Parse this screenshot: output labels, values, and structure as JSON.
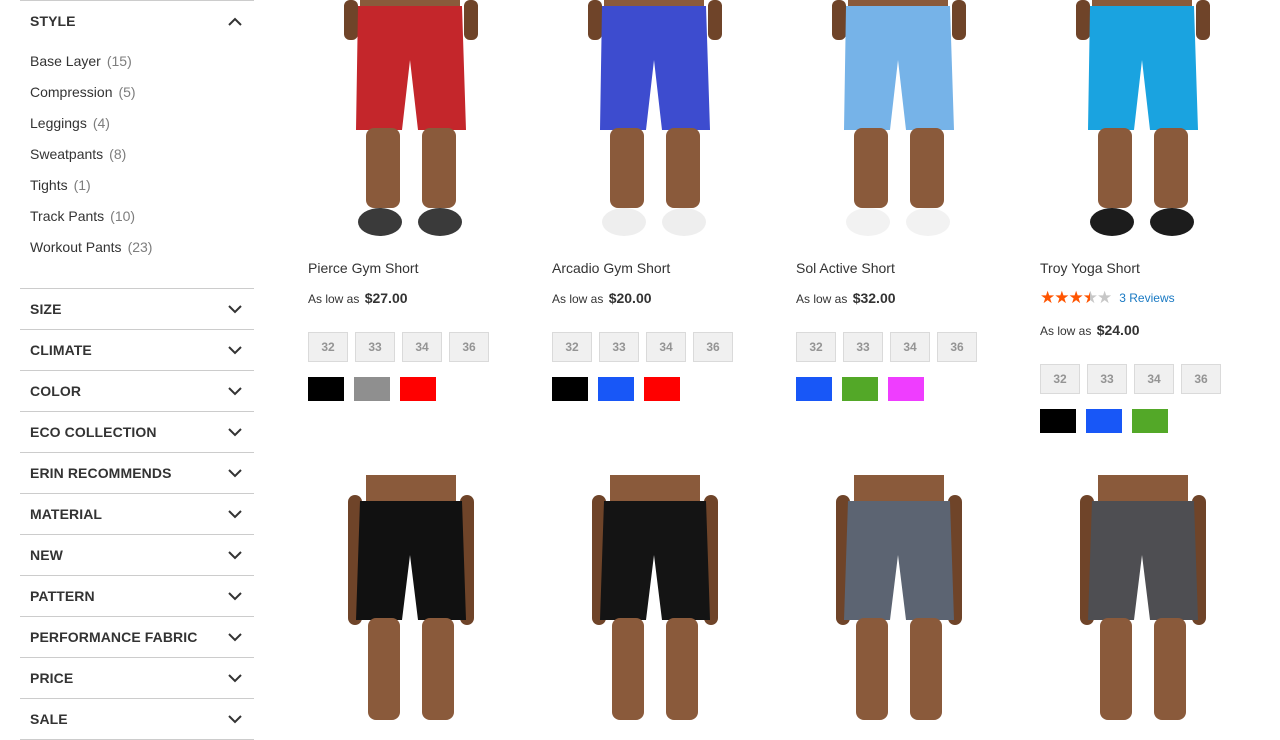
{
  "sidebar": {
    "style_title": "STYLE",
    "style_options": [
      {
        "label": "Base Layer",
        "count": "(15)"
      },
      {
        "label": "Compression",
        "count": "(5)"
      },
      {
        "label": "Leggings",
        "count": "(4)"
      },
      {
        "label": "Sweatpants",
        "count": "(8)"
      },
      {
        "label": "Tights",
        "count": "(1)"
      },
      {
        "label": "Track Pants",
        "count": "(10)"
      },
      {
        "label": "Workout Pants",
        "count": "(23)"
      }
    ],
    "filters": [
      "SIZE",
      "CLIMATE",
      "COLOR",
      "ECO COLLECTION",
      "ERIN RECOMMENDS",
      "MATERIAL",
      "NEW",
      "PATTERN",
      "PERFORMANCE FABRIC",
      "PRICE",
      "SALE"
    ]
  },
  "products": [
    {
      "name": "Pierce Gym Short",
      "price_prefix": "As low as",
      "price": "$27.00",
      "sizes": [
        "32",
        "33",
        "34",
        "36"
      ],
      "colors": [
        "#000000",
        "#8f8f8f",
        "#ff0000"
      ]
    },
    {
      "name": "Arcadio Gym Short",
      "price_prefix": "As low as",
      "price": "$20.00",
      "sizes": [
        "32",
        "33",
        "34",
        "36"
      ],
      "colors": [
        "#000000",
        "#1857f7",
        "#ff0000"
      ]
    },
    {
      "name": "Sol Active Short",
      "price_prefix": "As low as",
      "price": "$32.00",
      "sizes": [
        "32",
        "33",
        "34",
        "36"
      ],
      "colors": [
        "#1857f7",
        "#53a828",
        "#ef3dff"
      ]
    },
    {
      "name": "Troy Yoga Short",
      "rating_stars": 3.5,
      "reviews": "3 Reviews",
      "price_prefix": "As low as",
      "price": "$24.00",
      "sizes": [
        "32",
        "33",
        "34",
        "36"
      ],
      "colors": [
        "#000000",
        "#1857f7",
        "#53a828"
      ]
    }
  ],
  "lower_products": [
    {
      "shorts_color": "#111111"
    },
    {
      "shorts_color": "#141414"
    },
    {
      "shorts_color": "#5c6472"
    },
    {
      "shorts_color": "#4e4e52"
    }
  ],
  "photo_shorts_colors": [
    "#c4262b",
    "#3d4ccf",
    "#76b3e8",
    "#1aa3e0"
  ],
  "colors": {
    "star_on": "#ff5501",
    "star_off": "#c7c7c7",
    "link": "#1979c3",
    "border": "#cccccc"
  }
}
